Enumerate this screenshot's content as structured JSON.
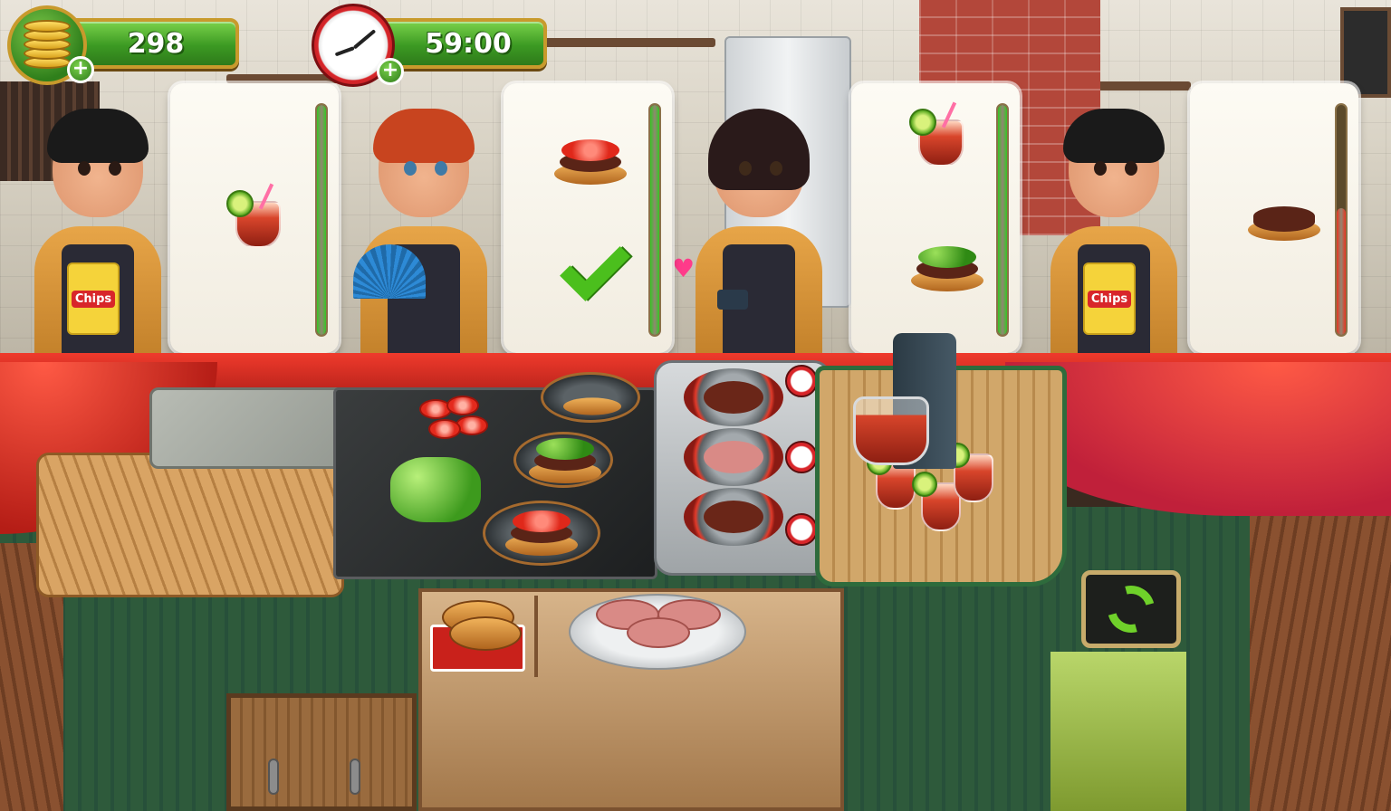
{
  "hud": {
    "coins": "298",
    "timer": "59:00",
    "coin_icon": "coins-icon",
    "clock_icon": "clock-icon",
    "add_icon": "plus-icon"
  },
  "customers": [
    {
      "name": "customer-boy-chips",
      "shirt": "#e7a548",
      "hair": "#1a1a1a",
      "order": [
        "iced-tea"
      ],
      "patience": 1.0,
      "patience_color": "#35c624",
      "served": false
    },
    {
      "name": "customer-redhead-fan",
      "shirt": "#e7a548",
      "hair": "#c8441f",
      "order": [
        "tomato-burger"
      ],
      "patience": 1.0,
      "patience_color": "#35c624",
      "served": true
    },
    {
      "name": "customer-girl-phone",
      "shirt": "#e7a548",
      "hair": "#2a1a1a",
      "order": [
        "iced-tea",
        "lettuce-burger"
      ],
      "patience": 1.0,
      "patience_color": "#35c624",
      "served": false
    },
    {
      "name": "customer-boy-chips-2",
      "shirt": "#e7a548",
      "hair": "#1a1a1a",
      "order": [
        "plain-burger"
      ],
      "patience": 0.55,
      "patience_color": "#e8341f",
      "served": false
    }
  ],
  "customer_labels": {
    "chips": "Chips"
  },
  "stations": {
    "grill_slots": 3,
    "prepared_burgers": 3,
    "drinks_ready": 4,
    "trash_icon": "recycle-icon"
  },
  "colors": {
    "hud_green": "#3c9a23",
    "hud_border": "#c89a2c",
    "counter_red": "#d12a20",
    "patience_ok": "#35c624",
    "patience_low": "#e8341f"
  }
}
